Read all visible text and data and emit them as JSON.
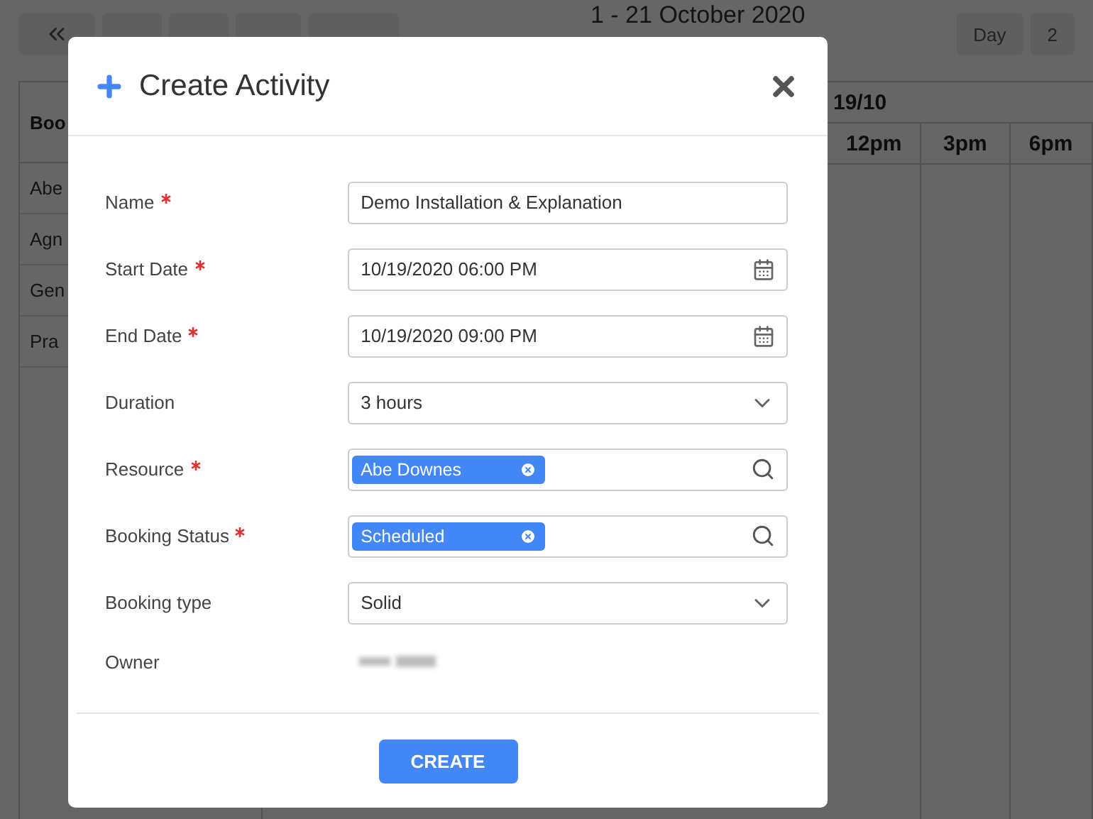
{
  "calendar": {
    "range_title": "1 - 21 October 2020",
    "view_buttons": [
      "Day",
      "2"
    ],
    "resource_header": "Boo",
    "resources": [
      "Abe",
      "Agn",
      "Gen",
      "Pra"
    ],
    "date_header": "19/10",
    "time_columns": [
      "12pm",
      "3pm",
      "6pm"
    ]
  },
  "dialog": {
    "title": "Create Activity",
    "fields": [
      {
        "kind": "text",
        "label": "Name",
        "required": true,
        "value": "Demo Installation & Explanation"
      },
      {
        "kind": "date",
        "label": "Start Date",
        "required": true,
        "value": "10/19/2020 06:00 PM"
      },
      {
        "kind": "date",
        "label": "End Date",
        "required": true,
        "value": "10/19/2020 09:00 PM"
      },
      {
        "kind": "select",
        "label": "Duration",
        "required": false,
        "value": "3 hours"
      },
      {
        "kind": "lookup",
        "label": "Resource",
        "required": true,
        "value": "Abe Downes"
      },
      {
        "kind": "lookup",
        "label": "Booking Status",
        "required": true,
        "value": "Scheduled"
      },
      {
        "kind": "select",
        "label": "Booking type",
        "required": false,
        "value": "Solid"
      },
      {
        "kind": "static",
        "label": "Owner",
        "required": false
      }
    ],
    "button": "CREATE"
  }
}
